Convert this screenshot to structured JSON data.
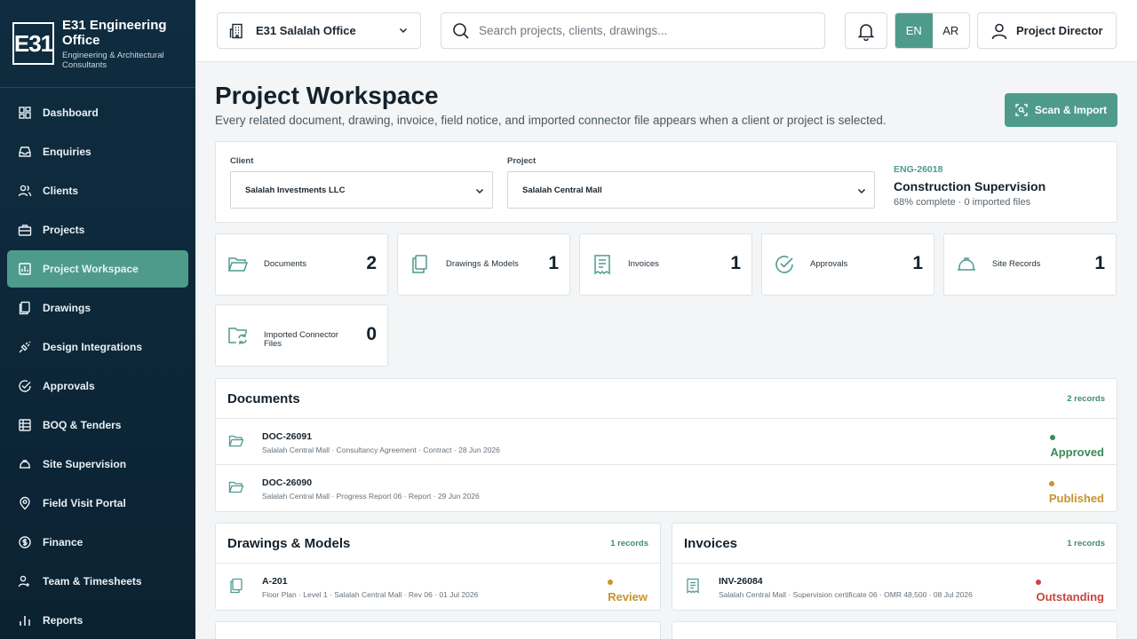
{
  "brand": {
    "logo_text": "E31",
    "name": "E31 Engineering Office",
    "subtitle": "Engineering & Architectural Consultants"
  },
  "sidebar": {
    "items": [
      {
        "label": "Dashboard",
        "icon": "dashboard-icon"
      },
      {
        "label": "Enquiries",
        "icon": "inbox-icon"
      },
      {
        "label": "Clients",
        "icon": "users-icon"
      },
      {
        "label": "Projects",
        "icon": "briefcase-icon"
      },
      {
        "label": "Project Workspace",
        "icon": "workspace-icon",
        "active": true
      },
      {
        "label": "Drawings",
        "icon": "drawings-icon"
      },
      {
        "label": "Design Integrations",
        "icon": "plug-icon"
      },
      {
        "label": "Approvals",
        "icon": "check-circle-icon"
      },
      {
        "label": "BOQ & Tenders",
        "icon": "table-icon"
      },
      {
        "label": "Site Supervision",
        "icon": "hardhat-icon"
      },
      {
        "label": "Field Visit Portal",
        "icon": "map-pin-icon"
      },
      {
        "label": "Finance",
        "icon": "finance-icon"
      },
      {
        "label": "Team & Timesheets",
        "icon": "team-icon"
      },
      {
        "label": "Reports",
        "icon": "bar-chart-icon"
      }
    ]
  },
  "topbar": {
    "office": "E31 Salalah Office",
    "search_placeholder": "Search projects, clients, drawings...",
    "lang_en": "EN",
    "lang_ar": "AR",
    "user": "Project Director"
  },
  "page": {
    "title": "Project Workspace",
    "subtitle": "Every related document, drawing, invoice, field notice, and imported connector file appears when a client or project is selected.",
    "scan_button": "Scan & Import"
  },
  "selector": {
    "client_label": "Client",
    "client_value": "Salalah Investments LLC",
    "project_label": "Project",
    "project_value": "Salalah Central Mall",
    "project_code": "ENG-26018",
    "project_name": "Construction Supervision",
    "project_meta": "68% complete · 0 imported files"
  },
  "stats": [
    {
      "label": "Documents",
      "value": "2",
      "icon": "folder-icon"
    },
    {
      "label": "Drawings & Models",
      "value": "1",
      "icon": "drawings-icon"
    },
    {
      "label": "Invoices",
      "value": "1",
      "icon": "receipt-icon"
    },
    {
      "label": "Approvals",
      "value": "1",
      "icon": "check-circle-icon"
    },
    {
      "label": "Site Records",
      "value": "1",
      "icon": "hardhat-icon"
    },
    {
      "label": "Imported Connector Files",
      "value": "0",
      "icon": "folder-sync-icon"
    }
  ],
  "documents": {
    "title": "Documents",
    "count": "2 records",
    "rows": [
      {
        "id": "DOC-26091",
        "meta": "Salalah Central Mall · Consultancy Agreement · Contract · 28 Jun 2026",
        "status": "Approved"
      },
      {
        "id": "DOC-26090",
        "meta": "Salalah Central Mall · Progress Report 06 · Report · 29 Jun 2026",
        "status": "Published"
      }
    ]
  },
  "drawings": {
    "title": "Drawings & Models",
    "count": "1 records",
    "rows": [
      {
        "id": "A-201",
        "meta": "Floor Plan · Level 1 · Salalah Central Mall · Rev 06 · 01 Jul 2026",
        "status": "Review"
      }
    ]
  },
  "invoices": {
    "title": "Invoices",
    "count": "1 records",
    "rows": [
      {
        "id": "INV-26084",
        "meta": "Salalah Central Mall · Supervision certificate 06 · OMR 48,500 · 08 Jul 2026",
        "status": "Outstanding"
      }
    ]
  },
  "colors": {
    "accent": "#4e9b8c",
    "sidebar": "#0f2d40",
    "approved": "#3b8a5a",
    "published": "#c8942d",
    "outstanding": "#c8443c"
  }
}
